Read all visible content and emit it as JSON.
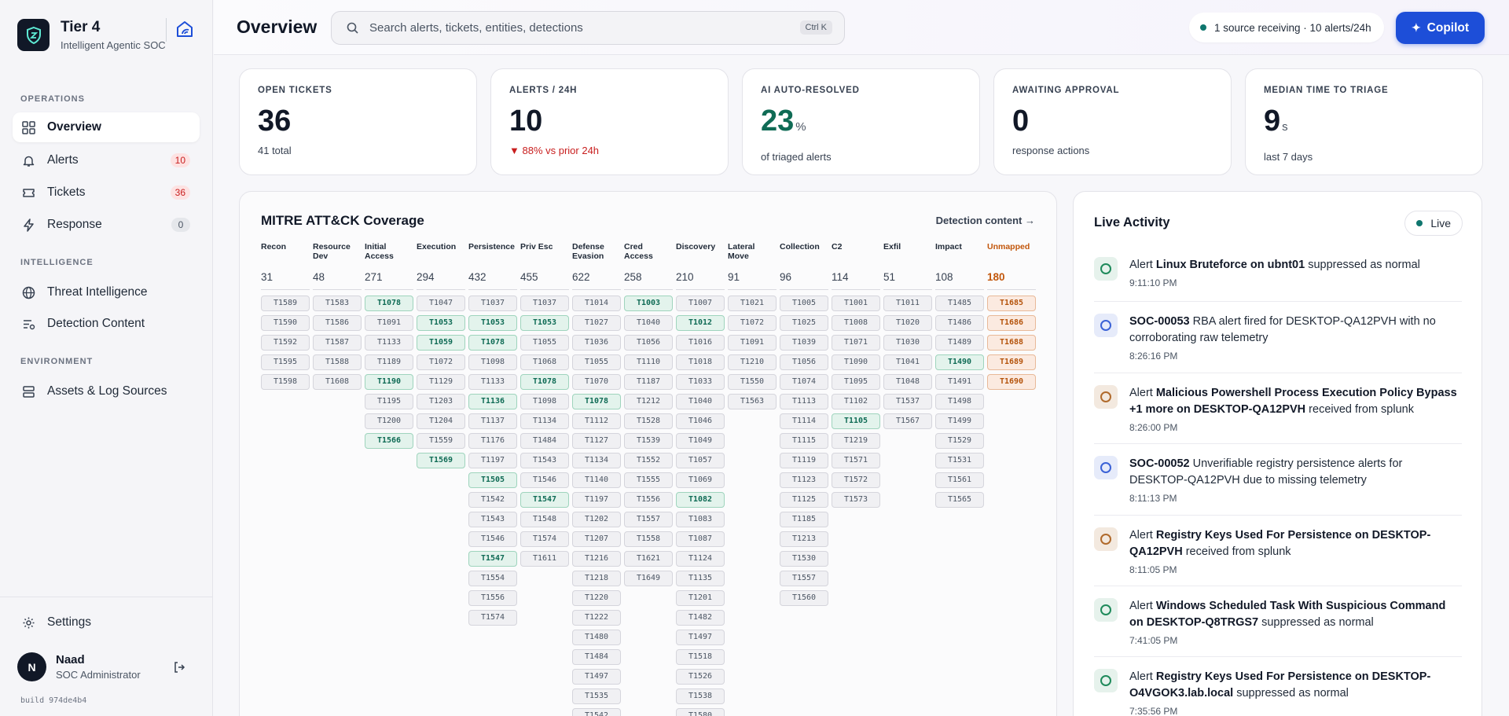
{
  "brand": {
    "title": "Tier 4",
    "subtitle": "Intelligent Agentic SOC"
  },
  "nav": {
    "operations_label": "OPERATIONS",
    "intelligence_label": "INTELLIGENCE",
    "environment_label": "ENVIRONMENT",
    "items": [
      {
        "label": "Overview",
        "icon": "grid-icon"
      },
      {
        "label": "Alerts",
        "badge": "10",
        "icon": "bell-icon"
      },
      {
        "label": "Tickets",
        "badge": "36",
        "icon": "ticket-icon"
      },
      {
        "label": "Response",
        "badge": "0",
        "icon": "bolt-icon"
      },
      {
        "label": "Threat Intelligence",
        "icon": "globe-icon"
      },
      {
        "label": "Detection Content",
        "icon": "filter-list-icon"
      },
      {
        "label": "Assets & Log Sources",
        "icon": "server-icon"
      }
    ],
    "settings_label": "Settings"
  },
  "user": {
    "initial": "N",
    "name": "Naad",
    "role": "SOC Administrator"
  },
  "build": "build 974de4b4",
  "header": {
    "title": "Overview",
    "search_placeholder": "Search alerts, tickets, entities, detections",
    "search_shortcut": "Ctrl K",
    "source_status": "1 source receiving · 10 alerts/24h",
    "copilot_label": "Copilot"
  },
  "stats": [
    {
      "label": "OPEN TICKETS",
      "value": "36",
      "unit": "",
      "sub": "41 total"
    },
    {
      "label": "ALERTS / 24H",
      "value": "10",
      "unit": "",
      "sub": "▼ 88% vs prior 24h"
    },
    {
      "label": "AI AUTO-RESOLVED",
      "value": "23",
      "unit": "%",
      "sub": "of triaged alerts"
    },
    {
      "label": "AWAITING APPROVAL",
      "value": "0",
      "unit": "",
      "sub": "response actions"
    },
    {
      "label": "MEDIAN TIME TO TRIAGE",
      "value": "9",
      "unit": "s",
      "sub": "last 7 days"
    }
  ],
  "mitre": {
    "title": "MITRE ATT&CK Coverage",
    "link": "Detection content →",
    "highlight_color": "#e3f3ec",
    "unmapped_color": "#fbeae0",
    "columns": [
      {
        "name": "Recon",
        "count": "31",
        "techniques": [
          "T1589",
          "T1590",
          "T1592",
          "T1595",
          "T1598"
        ],
        "highlighted": []
      },
      {
        "name": "Resource Dev",
        "count": "48",
        "techniques": [
          "T1583",
          "T1586",
          "T1587",
          "T1588",
          "T1608"
        ],
        "highlighted": []
      },
      {
        "name": "Initial Access",
        "count": "271",
        "techniques": [
          "T1078",
          "T1091",
          "T1133",
          "T1189",
          "T1190",
          "T1195",
          "T1200",
          "T1566"
        ],
        "highlighted": [
          "T1078",
          "T1190",
          "T1566"
        ]
      },
      {
        "name": "Execution",
        "count": "294",
        "techniques": [
          "T1047",
          "T1053",
          "T1059",
          "T1072",
          "T1129",
          "T1203",
          "T1204",
          "T1559",
          "T1569"
        ],
        "highlighted": [
          "T1053",
          "T1059",
          "T1569"
        ]
      },
      {
        "name": "Persistence",
        "count": "432",
        "techniques": [
          "T1037",
          "T1053",
          "T1078",
          "T1098",
          "T1133",
          "T1136",
          "T1137",
          "T1176",
          "T1197",
          "T1505",
          "T1542",
          "T1543",
          "T1546",
          "T1547",
          "T1554",
          "T1556",
          "T1574"
        ],
        "highlighted": [
          "T1053",
          "T1078",
          "T1136",
          "T1505",
          "T1547"
        ]
      },
      {
        "name": "Priv Esc",
        "count": "455",
        "techniques": [
          "T1037",
          "T1053",
          "T1055",
          "T1068",
          "T1078",
          "T1098",
          "T1134",
          "T1484",
          "T1543",
          "T1546",
          "T1547",
          "T1548",
          "T1574",
          "T1611"
        ],
        "highlighted": [
          "T1053",
          "T1078",
          "T1547"
        ]
      },
      {
        "name": "Defense Evasion",
        "count": "622",
        "techniques": [
          "T1014",
          "T1027",
          "T1036",
          "T1055",
          "T1070",
          "T1078",
          "T1112",
          "T1127",
          "T1134",
          "T1140",
          "T1197",
          "T1202",
          "T1207",
          "T1216",
          "T1218",
          "T1220",
          "T1222",
          "T1480",
          "T1484",
          "T1497",
          "T1535",
          "T1542"
        ],
        "highlighted": [
          "T1078"
        ]
      },
      {
        "name": "Cred Access",
        "count": "258",
        "techniques": [
          "T1003",
          "T1040",
          "T1056",
          "T1110",
          "T1187",
          "T1212",
          "T1528",
          "T1539",
          "T1552",
          "T1555",
          "T1556",
          "T1557",
          "T1558",
          "T1621",
          "T1649"
        ],
        "highlighted": [
          "T1003"
        ]
      },
      {
        "name": "Discovery",
        "count": "210",
        "techniques": [
          "T1007",
          "T1012",
          "T1016",
          "T1018",
          "T1033",
          "T1040",
          "T1046",
          "T1049",
          "T1057",
          "T1069",
          "T1082",
          "T1083",
          "T1087",
          "T1124",
          "T1135",
          "T1201",
          "T1482",
          "T1497",
          "T1518",
          "T1526",
          "T1538",
          "T1580"
        ],
        "highlighted": [
          "T1012",
          "T1082"
        ]
      },
      {
        "name": "Lateral Move",
        "count": "91",
        "techniques": [
          "T1021",
          "T1072",
          "T1091",
          "T1210",
          "T1550",
          "T1563"
        ],
        "highlighted": []
      },
      {
        "name": "Collection",
        "count": "96",
        "techniques": [
          "T1005",
          "T1025",
          "T1039",
          "T1056",
          "T1074",
          "T1113",
          "T1114",
          "T1115",
          "T1119",
          "T1123",
          "T1125",
          "T1185",
          "T1213",
          "T1530",
          "T1557",
          "T1560"
        ],
        "highlighted": []
      },
      {
        "name": "C2",
        "count": "114",
        "techniques": [
          "T1001",
          "T1008",
          "T1071",
          "T1090",
          "T1095",
          "T1102",
          "T1105",
          "T1219",
          "T1571",
          "T1572",
          "T1573"
        ],
        "highlighted": [
          "T1105"
        ]
      },
      {
        "name": "Exfil",
        "count": "51",
        "techniques": [
          "T1011",
          "T1020",
          "T1030",
          "T1041",
          "T1048",
          "T1537",
          "T1567"
        ],
        "highlighted": []
      },
      {
        "name": "Impact",
        "count": "108",
        "techniques": [
          "T1485",
          "T1486",
          "T1489",
          "T1490",
          "T1491",
          "T1498",
          "T1499",
          "T1529",
          "T1531",
          "T1561",
          "T1565"
        ],
        "highlighted": [
          "T1490"
        ]
      },
      {
        "name": "Unmapped",
        "count": "180",
        "techniques": [
          "T1685",
          "T1686",
          "T1688",
          "T1689",
          "T1690"
        ],
        "highlighted": [],
        "unmapped": true
      }
    ]
  },
  "activity": {
    "title": "Live Activity",
    "live_label": "Live",
    "items": [
      {
        "kind": "green",
        "parts": [
          [
            "Alert ",
            false
          ],
          [
            "Linux Bruteforce on ubnt01",
            true
          ],
          [
            " suppressed as normal",
            false
          ]
        ],
        "time": "9:11:10 PM"
      },
      {
        "kind": "blue",
        "parts": [
          [
            "SOC-00053",
            true
          ],
          [
            " RBA alert fired for DESKTOP-QA12PVH with no corroborating raw telemetry",
            false
          ]
        ],
        "time": "8:26:16 PM"
      },
      {
        "kind": "tan",
        "parts": [
          [
            "Alert ",
            false
          ],
          [
            "Malicious Powershell Process Execution Policy Bypass +1 more on DESKTOP-QA12PVH",
            true
          ],
          [
            " received from splunk",
            false
          ]
        ],
        "time": "8:26:00 PM"
      },
      {
        "kind": "blue",
        "parts": [
          [
            "SOC-00052",
            true
          ],
          [
            " Unverifiable registry persistence alerts for DESKTOP-QA12PVH due to missing telemetry",
            false
          ]
        ],
        "time": "8:11:13 PM"
      },
      {
        "kind": "tan",
        "parts": [
          [
            "Alert ",
            false
          ],
          [
            "Registry Keys Used For Persistence on DESKTOP-QA12PVH",
            true
          ],
          [
            " received from splunk",
            false
          ]
        ],
        "time": "8:11:05 PM"
      },
      {
        "kind": "green",
        "parts": [
          [
            "Alert ",
            false
          ],
          [
            "Windows Scheduled Task With Suspicious Command on DESKTOP-Q8TRGS7",
            true
          ],
          [
            " suppressed as normal",
            false
          ]
        ],
        "time": "7:41:05 PM"
      },
      {
        "kind": "green",
        "parts": [
          [
            "Alert ",
            false
          ],
          [
            "Registry Keys Used For Persistence on DESKTOP-O4VGOK3.lab.local",
            true
          ],
          [
            " suppressed as normal",
            false
          ]
        ],
        "time": "7:35:56 PM"
      }
    ]
  }
}
